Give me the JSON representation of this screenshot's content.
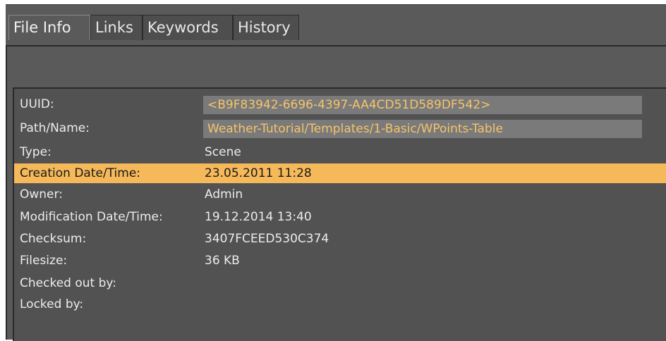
{
  "tabs": [
    {
      "label": "File Info",
      "active": true
    },
    {
      "label": "Links",
      "active": false
    },
    {
      "label": "Keywords",
      "active": false
    },
    {
      "label": "History",
      "active": false
    }
  ],
  "file_info": {
    "uuid_label": "UUID:",
    "uuid_value": "<B9F83942-6696-4397-AA4CD51D589DF542>",
    "path_label": "Path/Name:",
    "path_value": "Weather-Tutorial/Templates/1-Basic/WPoints-Table",
    "type_label": "Type:",
    "type_value": "Scene",
    "creation_label": "Creation Date/Time:",
    "creation_value": "23.05.2011 11:28",
    "owner_label": "Owner:",
    "owner_value": "Admin",
    "modification_label": "Modification Date/Time:",
    "modification_value": "19.12.2014 13:40",
    "checksum_label": "Checksum:",
    "checksum_value": "3407FCEED530C374",
    "filesize_label": "Filesize:",
    "filesize_value": "36 KB",
    "checked_out_label": "Checked out by:",
    "checked_out_value": "",
    "locked_label": "Locked by:",
    "locked_value": ""
  },
  "colors": {
    "highlight": "#f5b95a",
    "field_text": "#f5c46a",
    "panel_bg": "#525252"
  }
}
